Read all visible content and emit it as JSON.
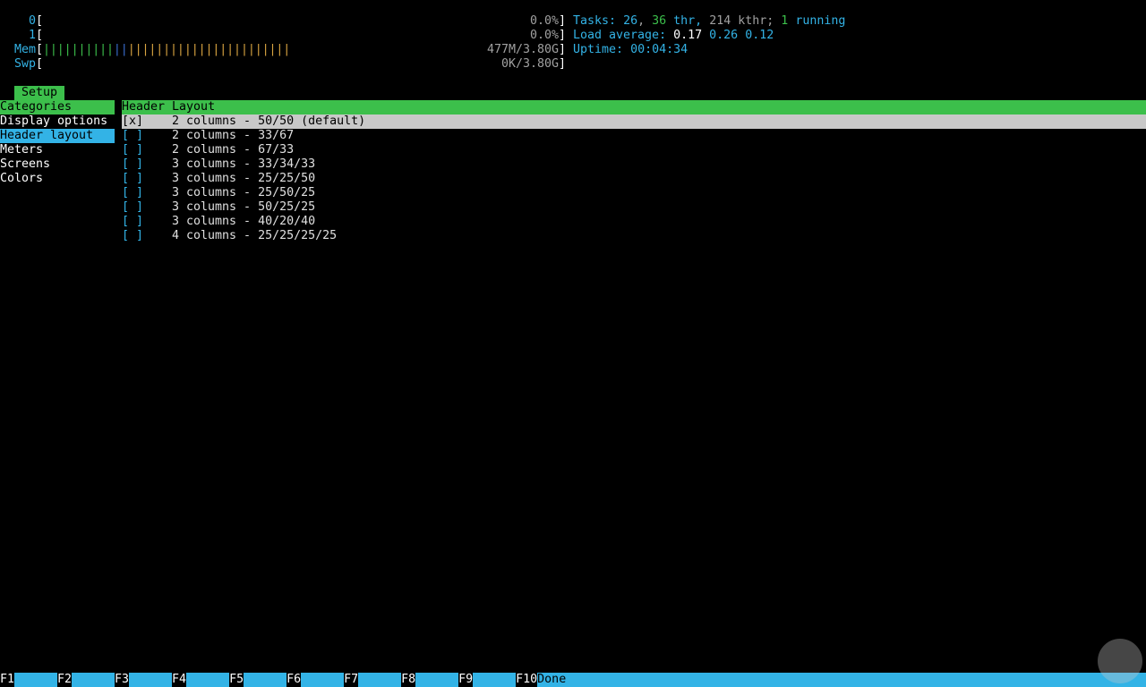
{
  "meters": {
    "cpu0": {
      "label": "0",
      "value": "0.0%"
    },
    "cpu1": {
      "label": "1",
      "value": "0.0%"
    },
    "mem": {
      "label": "Mem",
      "value": "477M/3.80G",
      "usage_fraction": 0.6
    },
    "swp": {
      "label": "Swp",
      "value": "0K/3.80G"
    }
  },
  "bracket_open": "[",
  "bracket_close": "]",
  "info": {
    "tasks_label": "Tasks:",
    "tasks_count": "26",
    "tasks_sep1": ",",
    "thr_count": "36",
    "thr_label": "thr,",
    "kthr_count": "214",
    "kthr_label": "kthr;",
    "running_count": "1",
    "running_label": "running",
    "load_label": "Load average:",
    "load1": "0.17",
    "load5": "0.26",
    "load15": "0.12",
    "uptime_label": "Uptime:",
    "uptime_value": "00:04:34"
  },
  "setup_tab": "Setup",
  "categories": {
    "header": "Categories",
    "items": [
      "Display options",
      "Header layout",
      "Meters",
      "Screens",
      "Colors"
    ],
    "selected_index": 1
  },
  "layout_panel": {
    "header": "Header Layout",
    "options": [
      {
        "check": "[x]",
        "label": "2 columns - 50/50 (default)"
      },
      {
        "check": "[ ]",
        "label": "2 columns - 33/67"
      },
      {
        "check": "[ ]",
        "label": "2 columns - 67/33"
      },
      {
        "check": "[ ]",
        "label": "3 columns - 33/34/33"
      },
      {
        "check": "[ ]",
        "label": "3 columns - 25/25/50"
      },
      {
        "check": "[ ]",
        "label": "3 columns - 25/50/25"
      },
      {
        "check": "[ ]",
        "label": "3 columns - 50/25/25"
      },
      {
        "check": "[ ]",
        "label": "3 columns - 40/20/40"
      },
      {
        "check": "[ ]",
        "label": "4 columns - 25/25/25/25"
      }
    ],
    "selected_index": 0
  },
  "footer": {
    "keys": [
      {
        "key": "F1",
        "label": ""
      },
      {
        "key": "F2",
        "label": ""
      },
      {
        "key": "F3",
        "label": ""
      },
      {
        "key": "F4",
        "label": ""
      },
      {
        "key": "F5",
        "label": ""
      },
      {
        "key": "F6",
        "label": ""
      },
      {
        "key": "F7",
        "label": ""
      },
      {
        "key": "F8",
        "label": ""
      },
      {
        "key": "F9",
        "label": ""
      },
      {
        "key": "F10",
        "label": "Done"
      }
    ]
  },
  "colors": {
    "accent_green": "#3cbf4b",
    "accent_cyan": "#33b3e6"
  }
}
